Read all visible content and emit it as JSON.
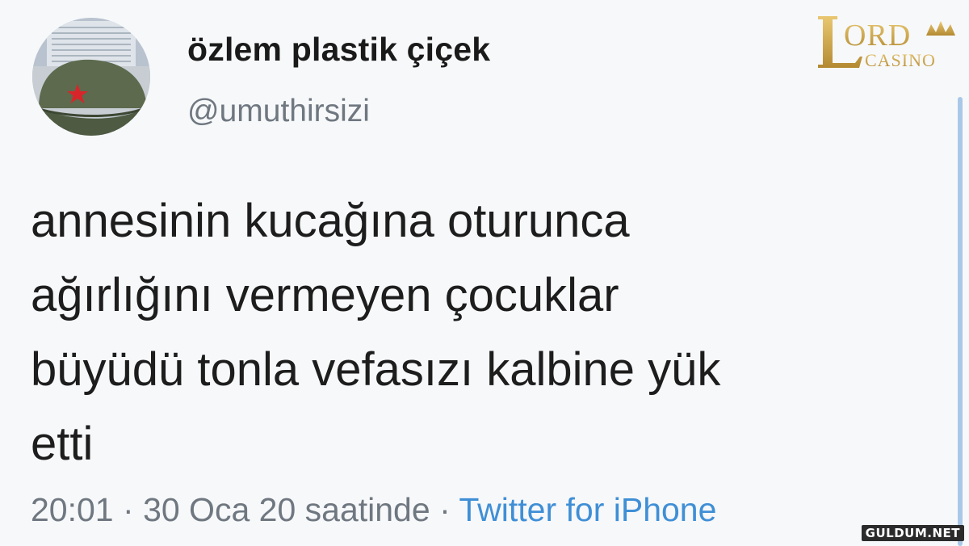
{
  "tweet": {
    "display_name": "özlem plastik çiçek",
    "handle": "@umuthirsizi",
    "text_lines": [
      "annesinin kucağına oturunca",
      "ağırlığını vermeyen çocuklar",
      "büyüdü tonla vefasızı kalbine yük",
      "etti"
    ],
    "time": "20:01",
    "date": "30 Oca 20 saatinde",
    "separator": "·",
    "source": "Twitter for iPhone"
  },
  "avatar": {
    "icon": "cap-with-red-star-icon"
  },
  "watermarks": {
    "logo_top_right": {
      "lord": "LORD",
      "casino": "CASINO",
      "color": "#c9a24a"
    },
    "bottom_right": "GULDUM.NET"
  },
  "colors": {
    "background": "#f7f8fa",
    "text": "#1d1d1d",
    "secondary_text": "#6f7780",
    "link": "#3f8fd6"
  }
}
